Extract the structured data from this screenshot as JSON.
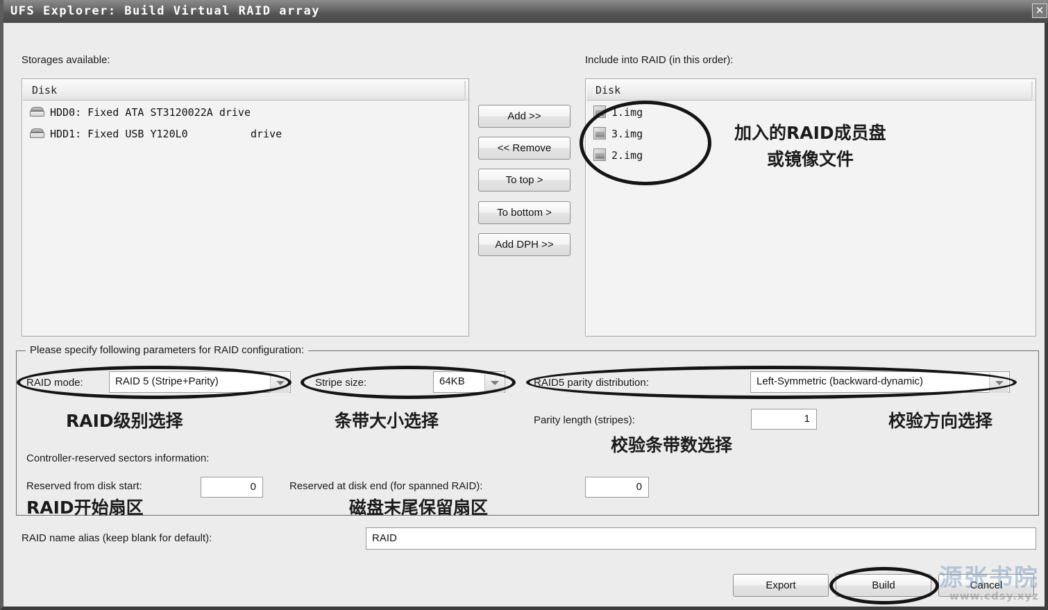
{
  "window": {
    "title": "UFS Explorer: Build Virtual RAID array",
    "close_icon": "close-icon"
  },
  "left_panel": {
    "label": "Storages available:",
    "column_header": "Disk",
    "rows": [
      {
        "icon": "hard-drive-icon",
        "text": "HDD0: Fixed ATA ST3120022A drive"
      },
      {
        "icon": "hard-drive-icon",
        "text": "HDD1: Fixed USB Y120L0          drive"
      }
    ]
  },
  "middle_buttons": [
    {
      "label": "Add >>"
    },
    {
      "label": "<< Remove"
    },
    {
      "label": "To top >"
    },
    {
      "label": "To bottom >"
    },
    {
      "label": "Add DPH >>"
    }
  ],
  "right_panel": {
    "label": "Include into RAID (in this order):",
    "column_header": "Disk",
    "rows": [
      {
        "icon": "disk-image-file-icon",
        "text": "1.img"
      },
      {
        "icon": "disk-image-file-icon",
        "text": "3.img"
      },
      {
        "icon": "disk-image-file-icon",
        "text": "2.img"
      }
    ]
  },
  "parameters": {
    "group_title": "Please specify following parameters for RAID configuration:",
    "raid_mode_label": "RAID mode:",
    "raid_mode_value": "RAID 5 (Stripe+Parity)",
    "stripe_size_label": "Stripe size:",
    "stripe_size_value": "64KB",
    "parity_distribution_label": "RAID5 parity distribution:",
    "parity_distribution_value": "Left-Symmetric (backward-dynamic)",
    "parity_length_label": "Parity length (stripes):",
    "parity_length_value": "1",
    "reserved_info_label": "Controller-reserved sectors information:",
    "reserved_start_label": "Reserved from disk start:",
    "reserved_start_value": "0",
    "reserved_end_label": "Reserved at disk end (for spanned RAID):",
    "reserved_end_value": "0"
  },
  "alias": {
    "label": "RAID name alias (keep blank for default):",
    "value": "RAID"
  },
  "actions": {
    "export_label": "Export",
    "build_label": "Build",
    "cancel_label": "Cancel"
  },
  "annotations": {
    "members": "加入的RAID成员盘",
    "members2": "或镜像文件",
    "raid_level": "RAID级别选择",
    "stripe_size": "条带大小选择",
    "parity_direction": "校验方向选择",
    "parity_stripes": "校验条带数选择",
    "raid_start": "RAID开始扇区",
    "disk_end": "磁盘末尾保留扇区"
  },
  "watermark": {
    "cn": "源张书院",
    "url": "www.cdsy.xyz"
  }
}
